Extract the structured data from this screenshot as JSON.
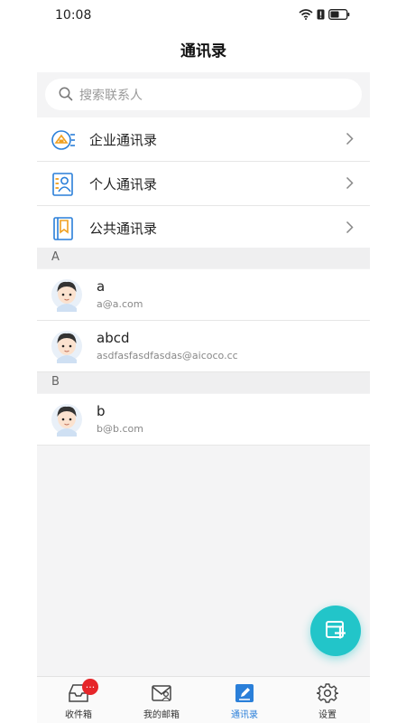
{
  "status_bar": {
    "time": "10:08"
  },
  "header": {
    "title": "通讯录"
  },
  "search": {
    "placeholder": "搜索联系人"
  },
  "menu": [
    {
      "label": "企业通讯录",
      "icon": "enterprise-contacts-icon"
    },
    {
      "label": "个人通讯录",
      "icon": "personal-contacts-icon"
    },
    {
      "label": "公共通讯录",
      "icon": "public-contacts-icon"
    }
  ],
  "sections": [
    {
      "letter": "A",
      "contacts": [
        {
          "name": "a",
          "email": "a@a.com"
        },
        {
          "name": "abcd",
          "email": "asdfasfasdfasdas@aicoco.cc"
        }
      ]
    },
    {
      "letter": "B",
      "contacts": [
        {
          "name": "b",
          "email": "b@b.com"
        }
      ]
    }
  ],
  "tabs": [
    {
      "label": "收件箱",
      "badge": "...",
      "active": false
    },
    {
      "label": "我的邮箱",
      "active": false
    },
    {
      "label": "通讯录",
      "active": true
    },
    {
      "label": "设置",
      "active": false
    }
  ],
  "colors": {
    "accent": "#2a7fd9",
    "fab": "#22c5c9",
    "icon_orange": "#f0a020",
    "icon_blue": "#2a7fd9",
    "badge": "#e6262a"
  }
}
